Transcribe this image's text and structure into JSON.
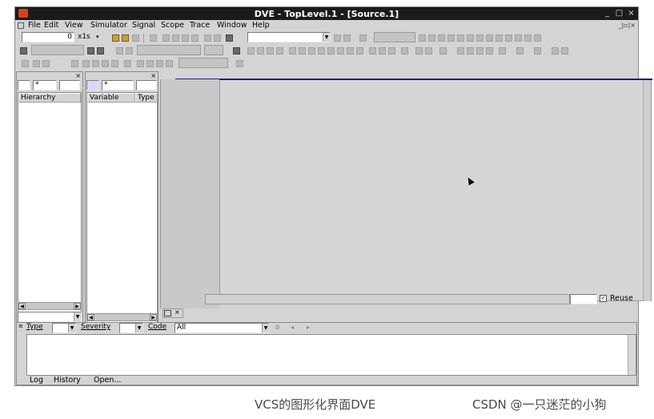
{
  "window": {
    "title": "DVE - TopLevel.1 - [Source.1]",
    "controls": [
      "_",
      "□",
      "×"
    ],
    "mdi_controls": "_|▫|×"
  },
  "menu": [
    "File",
    "Edit",
    "View",
    "Simulator",
    "Signal",
    "Scope",
    "Trace",
    "Window",
    "Help"
  ],
  "toolbar": {
    "time_value": "0",
    "time_unit": "x1s"
  },
  "hierarchy_pane": {
    "filter_value": "*",
    "column_header": "Hierarchy"
  },
  "variable_pane": {
    "filter_value": "*",
    "column_headers": [
      "Variable",
      "Type"
    ]
  },
  "source": {
    "reuse_label": "Reuse",
    "reuse_checked": true
  },
  "console": {
    "type_label": "Type",
    "severity_label": "Severity",
    "code_label": "Code",
    "code_value": "All",
    "tabs": [
      "Log",
      "History",
      "Open..."
    ]
  },
  "caption": {
    "left": "VCS的图形化界面DVE",
    "right": "CSDN @一只迷茫的小狗"
  }
}
